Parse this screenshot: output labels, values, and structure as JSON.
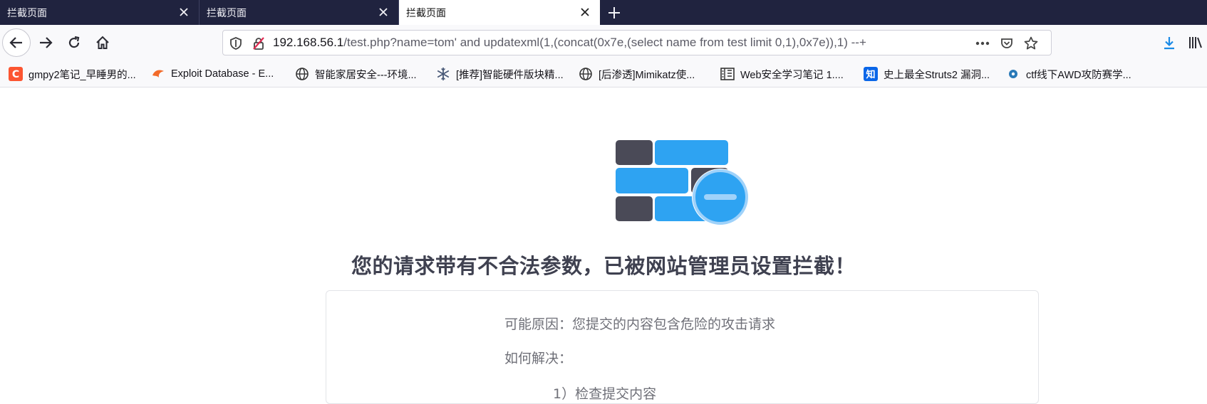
{
  "tabs": [
    {
      "title": "拦截页面",
      "active": false
    },
    {
      "title": "拦截页面",
      "active": false
    },
    {
      "title": "拦截页面",
      "active": true
    }
  ],
  "urlbar": {
    "host": "192.168.56.1",
    "path": "/test.php?name=tom' and updatexml(1,(concat(0x7e,(select name from test limit 0,1),0x7e)),1) --+"
  },
  "bookmarks": [
    {
      "label": "gmpy2笔记_早睡男的...",
      "icon": "csdn-icon"
    },
    {
      "label": "Exploit Database - E...",
      "icon": "exploit-db-icon"
    },
    {
      "label": "智能家居安全---环境...",
      "icon": "globe-icon"
    },
    {
      "label": "[推荐]智能硬件版块精...",
      "icon": "snowflake-icon"
    },
    {
      "label": "[后渗透]Mimikatz使...",
      "icon": "globe-icon"
    },
    {
      "label": "Web安全学习笔记 1....",
      "icon": "book-icon"
    },
    {
      "label": "史上最全Struts2 漏洞...",
      "icon": "zhihu-icon"
    },
    {
      "label": "ctf线下AWD攻防赛学...",
      "icon": "cnblogs-icon"
    }
  ],
  "page": {
    "headline": "您的请求带有不合法参数，已被网站管理员设置拦截！",
    "reason": "可能原因：您提交的内容包含危险的攻击请求",
    "solution_label": "如何解决：",
    "step1": "1）检查提交内容"
  },
  "colors": {
    "tabbar": "#20233f",
    "brick_dark": "#4a4a57",
    "brick_blue": "#2ea3f2",
    "download_icon": "#1a8ae6"
  }
}
